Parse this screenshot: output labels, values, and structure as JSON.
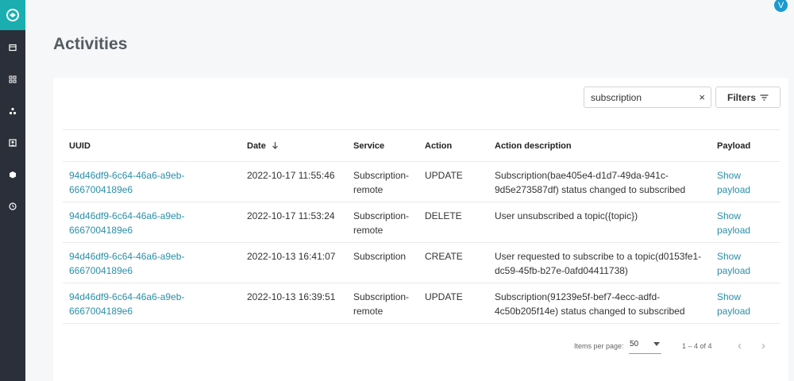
{
  "header": {
    "avatar_initial": "V"
  },
  "sidebar": {
    "items": [
      {
        "icon": "document-icon"
      },
      {
        "icon": "grid-icon"
      },
      {
        "icon": "network-icon"
      },
      {
        "icon": "portrait-icon"
      },
      {
        "icon": "cube-icon"
      },
      {
        "icon": "clock-icon"
      }
    ]
  },
  "page": {
    "title": "Activities"
  },
  "toolbar": {
    "search_value": "subscription",
    "clear_symbol": "×",
    "filters_label": "Filters"
  },
  "table": {
    "columns": [
      "UUID",
      "Date",
      "Service",
      "Action",
      "Action description",
      "Payload"
    ],
    "rows": [
      {
        "uuid": "94d46df9-6c64-46a6-a9eb-6667004189e6",
        "date": "2022-10-17 11:55:46",
        "service": "Subscription-remote",
        "action": "UPDATE",
        "description": "Subscription(bae405e4-d1d7-49da-941c-9d5e273587df) status changed to subscribed",
        "payload": "Show payload"
      },
      {
        "uuid": "94d46df9-6c64-46a6-a9eb-6667004189e6",
        "date": "2022-10-17 11:53:24",
        "service": "Subscription-remote",
        "action": "DELETE",
        "description": "User unsubscribed a topic({topic})",
        "payload": "Show payload"
      },
      {
        "uuid": "94d46df9-6c64-46a6-a9eb-6667004189e6",
        "date": "2022-10-13 16:41:07",
        "service": "Subscription",
        "action": "CREATE",
        "description": "User requested to subscribe to a topic(d0153fe1-dc59-45fb-b27e-0afd04411738)",
        "payload": "Show payload"
      },
      {
        "uuid": "94d46df9-6c64-46a6-a9eb-6667004189e6",
        "date": "2022-10-13 16:39:51",
        "service": "Subscription-remote",
        "action": "UPDATE",
        "description": "Subscription(91239e5f-bef7-4ecc-adfd-4c50b205f14e) status changed to subscribed",
        "payload": "Show payload"
      }
    ]
  },
  "pagination": {
    "items_per_page_label": "Items per page:",
    "items_per_page": "50",
    "range": "1 – 4 of 4",
    "prev_symbol": "‹",
    "next_symbol": "›"
  },
  "colors": {
    "accent": "#1aaeb0",
    "sidebar": "#2b2f3a",
    "link": "#2a8fa8",
    "avatar": "#1a9bd0"
  }
}
